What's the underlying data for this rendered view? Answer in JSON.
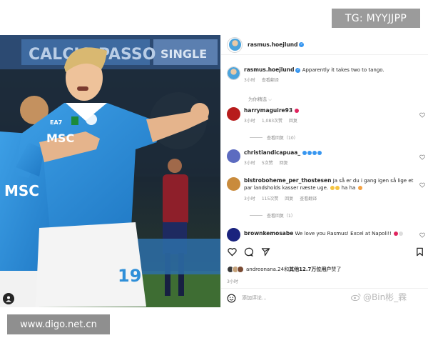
{
  "watermarks": {
    "telegram": "TG: MYYJJPP",
    "site": "www.digo.net.cn",
    "weibo": "@Bin彬_霖"
  },
  "photo": {
    "banner_text": "CALCIO PASSO",
    "banner_text_2": "SINGLE",
    "sponsor": "MSC",
    "kit_brand": "EA7",
    "shorts_number": "19"
  },
  "post": {
    "author": "rasmus.hoejlund",
    "caption_author": "rasmus.hoejlund",
    "caption": "Apparently it takes two to tango.",
    "caption_time": "3小时",
    "caption_translate": "查看翻译",
    "filter_label": "为你精选",
    "actions": {
      "like_icon": "heart-icon",
      "comment_icon": "comment-icon",
      "share_icon": "send-icon",
      "save_icon": "bookmark-icon"
    },
    "likes_prefix": "andreonana.24和",
    "likes_bold": "其他12.7万位用户",
    "likes_suffix": "赞了",
    "date": "3小时",
    "add_comment_placeholder": "添加评论..."
  },
  "comments": [
    {
      "user": "harrymaguire93",
      "text": "",
      "emoji_color": "#e0245e",
      "time": "3小时",
      "likes": "1,083次赞",
      "reply": "回复",
      "replies": "查看回复（10）",
      "avatar_color": "#b71c1c"
    },
    {
      "user": "christiandicapuaa_",
      "text": "",
      "emoji_color": "#3897f0",
      "time": "3小时",
      "likes": "5次赞",
      "reply": "回复",
      "replies": "",
      "avatar_color": "#5c6bc0"
    },
    {
      "user": "bistroboheme_per_thostesen",
      "text": "Ja så er du i gang igen så lige et par landsholds kasser næste uge.",
      "text_tail": "ha ha",
      "time": "3小时",
      "likes": "115次赞",
      "reply": "回复",
      "translate": "查看翻译",
      "replies": "查看回复（1）",
      "avatar_color": "#c98b3c"
    },
    {
      "user": "brownkemosabe",
      "text": "We love you Rasmus! Excel at Napoli!!",
      "avatar_color": "#1a237e"
    }
  ],
  "colors": {
    "napoli_blue": "#2f8fd8",
    "ig_blue": "#3897f0",
    "text": "#262626",
    "muted": "#8e8e8e"
  }
}
